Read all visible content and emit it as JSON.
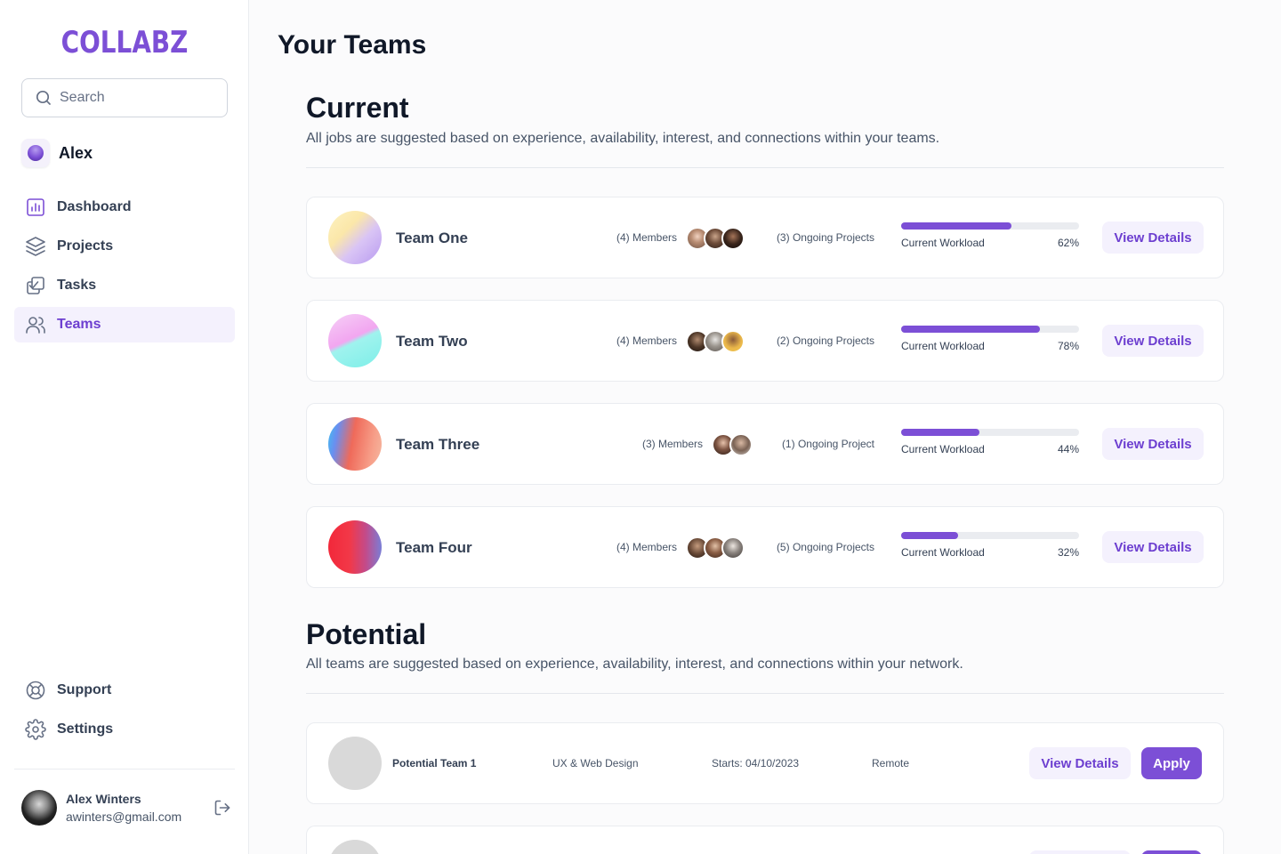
{
  "brand": {
    "logo": "COLLABZ",
    "accent": "#7c4fd6"
  },
  "search": {
    "placeholder": "Search"
  },
  "workspace": {
    "name": "Alex"
  },
  "nav": {
    "items": [
      {
        "label": "Dashboard",
        "icon": "bar-chart-icon"
      },
      {
        "label": "Projects",
        "icon": "layers-icon"
      },
      {
        "label": "Tasks",
        "icon": "check-square-icon"
      },
      {
        "label": "Teams",
        "icon": "users-icon",
        "active": true
      }
    ],
    "bottom": [
      {
        "label": "Support",
        "icon": "life-buoy-icon"
      },
      {
        "label": "Settings",
        "icon": "gear-icon"
      }
    ]
  },
  "user": {
    "name": "Alex Winters",
    "email": "awinters@gmail.com"
  },
  "page": {
    "title": "Your Teams"
  },
  "current": {
    "title": "Current",
    "subtitle": "All jobs are suggested based on experience, availability, interest, and connections within your teams.",
    "teams": [
      {
        "name": "Team One",
        "members": "(4) Members",
        "member_count": 4,
        "projects": "(3) Ongoing Projects",
        "workload_label": "Current Workload",
        "workload_pct": "62%",
        "workload": 0.62,
        "button": "View Details"
      },
      {
        "name": "Team Two",
        "members": "(4) Members",
        "member_count": 4,
        "projects": "(2) Ongoing Projects",
        "workload_label": "Current Workload",
        "workload_pct": "78%",
        "workload": 0.78,
        "button": "View Details"
      },
      {
        "name": "Team Three",
        "members": "(3) Members",
        "member_count": 3,
        "projects": "(1) Ongoing Project",
        "workload_label": "Current Workload",
        "workload_pct": "44%",
        "workload": 0.44,
        "button": "View Details"
      },
      {
        "name": "Team Four",
        "members": "(4) Members",
        "member_count": 4,
        "projects": "(5) Ongoing Projects",
        "workload_label": "Current Workload",
        "workload_pct": "32%",
        "workload": 0.32,
        "button": "View Details"
      }
    ]
  },
  "potential": {
    "title": "Potential",
    "subtitle": "All teams are suggested based on experience, availability, interest, and connections within your network.",
    "teams": [
      {
        "name": "Potential Team 1",
        "category": "UX & Web Design",
        "starts": "Starts: 04/10/2023",
        "location": "Remote",
        "view_button": "View Details",
        "apply_button": "Apply"
      }
    ]
  }
}
